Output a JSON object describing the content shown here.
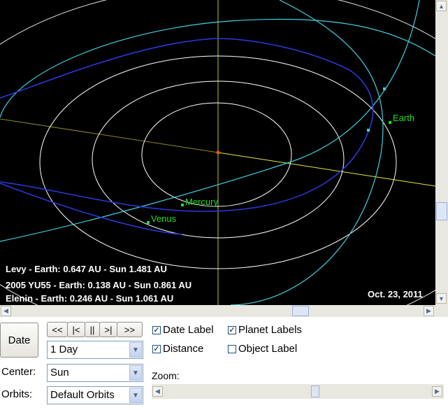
{
  "info_lines": [
    "Levy - Earth: 0.647 AU  - Sun 1.481 AU",
    "2005 YU55 - Earth: 0.138 AU  - Sun 0.861 AU",
    "Elenin - Earth: 0.246 AU  - Sun 1.061 AU"
  ],
  "current_date": "Oct. 23, 2011",
  "planets": {
    "mercury": "Mercury",
    "venus": "Venus",
    "earth": "Earth"
  },
  "controls": {
    "date_button": "Date",
    "nav": {
      "rewind": "<<",
      "step_back": "|<",
      "pause": "||",
      "step_forward": ">|",
      "fast_forward": ">>"
    },
    "step": "1 Day",
    "center_label": "Center:",
    "center_value": "Sun",
    "orbits_label": "Orbits:",
    "orbits_value": "Default Orbits",
    "zoom_label": "Zoom:",
    "checkboxes": {
      "date_label": {
        "label": "Date Label",
        "checked": true
      },
      "planet_labels": {
        "label": "Planet Labels",
        "checked": true
      },
      "distance": {
        "label": "Distance",
        "checked": true
      },
      "object_label": {
        "label": "Object Label",
        "checked": false
      }
    }
  },
  "colors": {
    "background": "#000000",
    "orbit": "#ffffff",
    "comet_cyan": "#40d0e0",
    "asteroid_blue": "#2a3ae0",
    "axis": "#ffff40",
    "planet": "#22dd22"
  },
  "icons": {
    "scroll_up": "triangle-up",
    "scroll_down": "triangle-down",
    "scroll_left": "triangle-left",
    "scroll_right": "triangle-right",
    "dropdown": "chevron-down"
  }
}
